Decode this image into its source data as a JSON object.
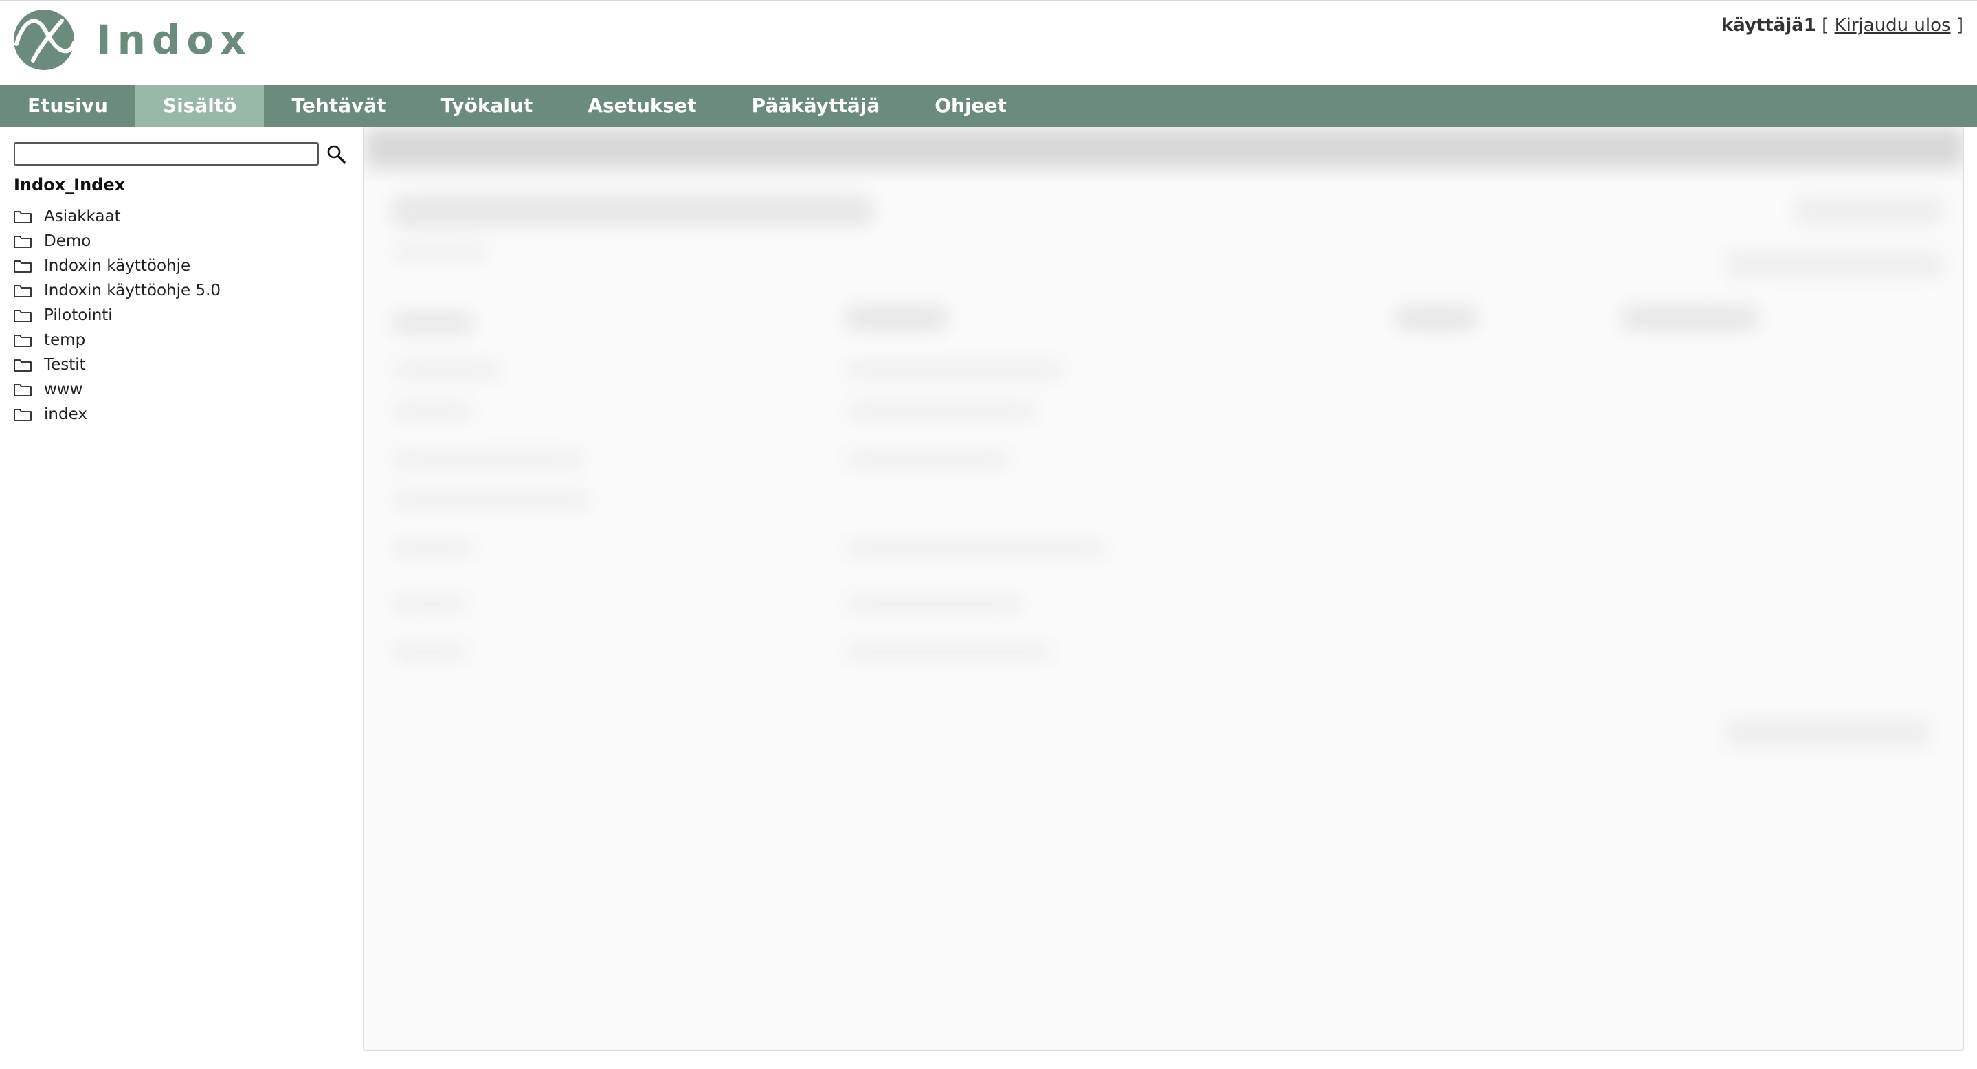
{
  "app": {
    "logo_text": "Indox",
    "brand_color": "#6b8c7d",
    "nav_active_color": "#98b8a8"
  },
  "user": {
    "name": "käyttäjä1",
    "bracket_open": "[",
    "logout_label": "Kirjaudu ulos",
    "bracket_close": "]"
  },
  "nav": {
    "items": [
      {
        "label": "Etusivu",
        "active": false
      },
      {
        "label": "Sisältö",
        "active": true
      },
      {
        "label": "Tehtävät",
        "active": false
      },
      {
        "label": "Työkalut",
        "active": false
      },
      {
        "label": "Asetukset",
        "active": false
      },
      {
        "label": "Pääkäyttäjä",
        "active": false
      },
      {
        "label": "Ohjeet",
        "active": false
      }
    ]
  },
  "sidebar": {
    "search": {
      "value": "",
      "icon": "magnifier-icon"
    },
    "root_label": "Indox_Index",
    "folders": [
      {
        "label": "Asiakkaat",
        "icon": "folder-icon"
      },
      {
        "label": "Demo",
        "icon": "folder-icon"
      },
      {
        "label": "Indoxin käyttöohje",
        "icon": "folder-icon"
      },
      {
        "label": "Indoxin käyttöohje 5.0",
        "icon": "folder-icon"
      },
      {
        "label": "Pilotointi",
        "icon": "folder-icon"
      },
      {
        "label": "temp",
        "icon": "folder-icon"
      },
      {
        "label": "Testit",
        "icon": "folder-icon"
      },
      {
        "label": "www",
        "icon": "folder-icon"
      },
      {
        "label": "index",
        "icon": "folder-icon"
      }
    ]
  }
}
